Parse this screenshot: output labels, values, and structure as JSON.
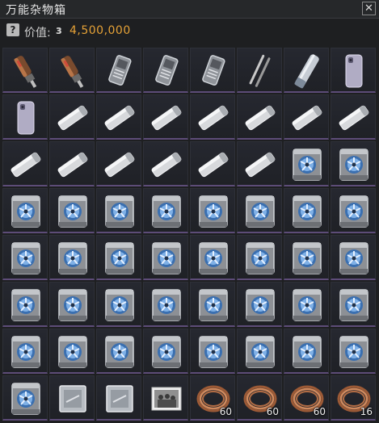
{
  "window": {
    "title": "万能杂物箱",
    "close_label": "✕"
  },
  "info": {
    "help_label": "?",
    "value_label": "价值:",
    "currency_symbol": "ɜ",
    "value": "4,500,000"
  },
  "grid": {
    "columns": 8,
    "items": [
      {
        "type": "screwdriver",
        "count": ""
      },
      {
        "type": "screwdriver",
        "count": ""
      },
      {
        "type": "cpu-cooler",
        "count": ""
      },
      {
        "type": "cpu-cooler",
        "count": ""
      },
      {
        "type": "cpu-cooler",
        "count": ""
      },
      {
        "type": "stylus",
        "count": ""
      },
      {
        "type": "tube",
        "count": ""
      },
      {
        "type": "phone",
        "count": ""
      },
      {
        "type": "phone",
        "count": ""
      },
      {
        "type": "blade",
        "count": ""
      },
      {
        "type": "blade",
        "count": ""
      },
      {
        "type": "blade",
        "count": ""
      },
      {
        "type": "blade",
        "count": ""
      },
      {
        "type": "blade",
        "count": ""
      },
      {
        "type": "blade",
        "count": ""
      },
      {
        "type": "blade",
        "count": ""
      },
      {
        "type": "blade",
        "count": ""
      },
      {
        "type": "blade",
        "count": ""
      },
      {
        "type": "blade",
        "count": ""
      },
      {
        "type": "blade",
        "count": ""
      },
      {
        "type": "blade",
        "count": ""
      },
      {
        "type": "blade",
        "count": ""
      },
      {
        "type": "fan-cooler",
        "count": ""
      },
      {
        "type": "fan-cooler",
        "count": ""
      },
      {
        "type": "fan-cooler",
        "count": ""
      },
      {
        "type": "fan-cooler",
        "count": ""
      },
      {
        "type": "fan-cooler",
        "count": ""
      },
      {
        "type": "fan-cooler",
        "count": ""
      },
      {
        "type": "fan-cooler",
        "count": ""
      },
      {
        "type": "fan-cooler",
        "count": ""
      },
      {
        "type": "fan-cooler",
        "count": ""
      },
      {
        "type": "fan-cooler",
        "count": ""
      },
      {
        "type": "fan-cooler",
        "count": ""
      },
      {
        "type": "fan-cooler",
        "count": ""
      },
      {
        "type": "fan-cooler",
        "count": ""
      },
      {
        "type": "fan-cooler",
        "count": ""
      },
      {
        "type": "fan-cooler",
        "count": ""
      },
      {
        "type": "fan-cooler",
        "count": ""
      },
      {
        "type": "fan-cooler",
        "count": ""
      },
      {
        "type": "fan-cooler",
        "count": ""
      },
      {
        "type": "fan-cooler",
        "count": ""
      },
      {
        "type": "fan-cooler",
        "count": ""
      },
      {
        "type": "fan-cooler",
        "count": ""
      },
      {
        "type": "fan-cooler",
        "count": ""
      },
      {
        "type": "fan-cooler",
        "count": ""
      },
      {
        "type": "fan-cooler",
        "count": ""
      },
      {
        "type": "fan-cooler",
        "count": ""
      },
      {
        "type": "fan-cooler",
        "count": ""
      },
      {
        "type": "fan-cooler",
        "count": ""
      },
      {
        "type": "fan-cooler",
        "count": ""
      },
      {
        "type": "fan-cooler",
        "count": ""
      },
      {
        "type": "fan-cooler",
        "count": ""
      },
      {
        "type": "fan-cooler",
        "count": ""
      },
      {
        "type": "fan-cooler",
        "count": ""
      },
      {
        "type": "fan-cooler",
        "count": ""
      },
      {
        "type": "fan-cooler",
        "count": ""
      },
      {
        "type": "fan-cooler",
        "count": ""
      },
      {
        "type": "chip",
        "count": ""
      },
      {
        "type": "chip",
        "count": ""
      },
      {
        "type": "photo",
        "count": ""
      },
      {
        "type": "copper-coil",
        "count": "60"
      },
      {
        "type": "copper-coil",
        "count": "60"
      },
      {
        "type": "copper-coil",
        "count": "60"
      },
      {
        "type": "copper-coil",
        "count": "16"
      }
    ]
  },
  "colors": {
    "value": "#e6a237",
    "rarity_bar": "#5d4c78"
  }
}
